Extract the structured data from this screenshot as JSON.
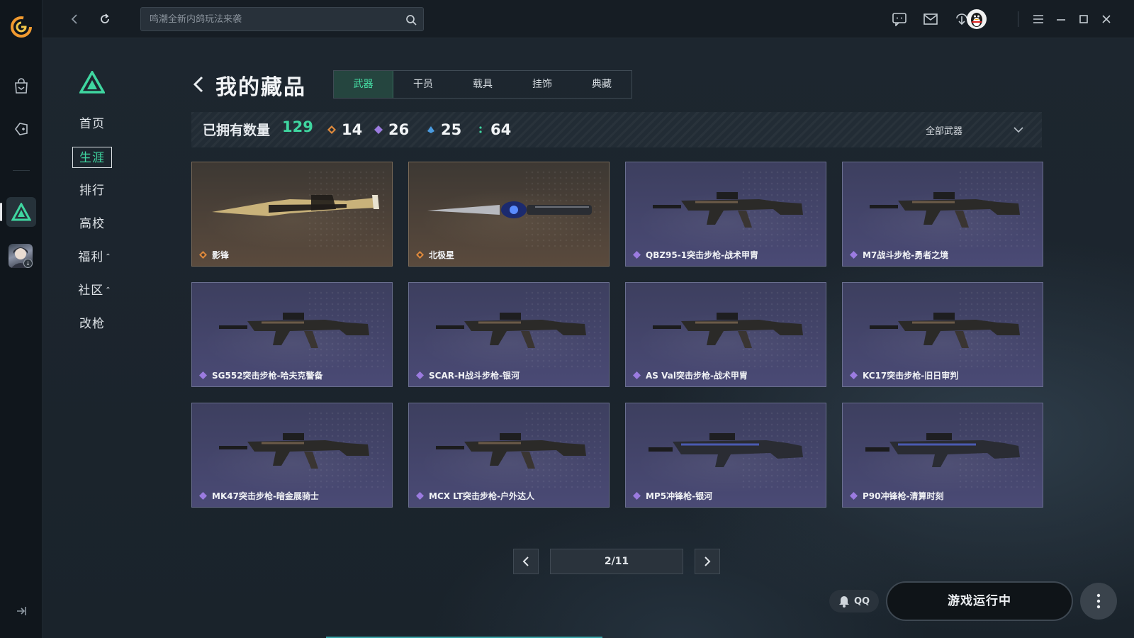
{
  "topbar": {
    "search_placeholder": "鸣潮全新内鸽玩法来袭"
  },
  "subnav": {
    "items": [
      {
        "label": "首页"
      },
      {
        "label": "生涯"
      },
      {
        "label": "排行"
      },
      {
        "label": "高校"
      },
      {
        "label": "福利"
      },
      {
        "label": "社区"
      },
      {
        "label": "改枪"
      }
    ],
    "active_index": 1
  },
  "page": {
    "title": "我的藏品",
    "tabs": [
      "武器",
      "干员",
      "载具",
      "挂饰",
      "典藏"
    ],
    "active_tab": "武器"
  },
  "stats": {
    "owned_label": "已拥有数量",
    "owned_value": "129",
    "rarities": [
      {
        "value": "14",
        "color": "#e08a3c"
      },
      {
        "value": "26",
        "color": "#9b7be0"
      },
      {
        "value": "25",
        "color": "#4a9be0"
      },
      {
        "value": "64",
        "color": "#3fd6a0"
      }
    ],
    "filter_label": "全部武器"
  },
  "cards": [
    {
      "name": "影锋",
      "rarity": "gold",
      "gem_color": "#e08a3c",
      "kind": "blade"
    },
    {
      "name": "北极星",
      "rarity": "gold",
      "gem_color": "#e08a3c",
      "kind": "knife"
    },
    {
      "name": "QBZ95-1突击步枪-战术甲胄",
      "rarity": "purple",
      "gem_color": "#9b7be0",
      "kind": "rifle"
    },
    {
      "name": "M7战斗步枪-勇者之境",
      "rarity": "purple",
      "gem_color": "#9b7be0",
      "kind": "rifle"
    },
    {
      "name": "SG552突击步枪-哈夫克警备",
      "rarity": "purple",
      "gem_color": "#9b7be0",
      "kind": "rifle"
    },
    {
      "name": "SCAR-H战斗步枪-银河",
      "rarity": "purple",
      "gem_color": "#9b7be0",
      "kind": "rifle"
    },
    {
      "name": "AS Val突击步枪-战术甲胄",
      "rarity": "purple",
      "gem_color": "#9b7be0",
      "kind": "rifle"
    },
    {
      "name": "KC17突击步枪-旧日审判",
      "rarity": "purple",
      "gem_color": "#9b7be0",
      "kind": "rifle"
    },
    {
      "name": "MK47突击步枪-暗金展骑士",
      "rarity": "purple",
      "gem_color": "#9b7be0",
      "kind": "rifle"
    },
    {
      "name": "MCX LT突击步枪-户外达人",
      "rarity": "purple",
      "gem_color": "#9b7be0",
      "kind": "rifle"
    },
    {
      "name": "MP5冲锋枪-银河",
      "rarity": "purple",
      "gem_color": "#9b7be0",
      "kind": "smg"
    },
    {
      "name": "P90冲锋枪-清算时刻",
      "rarity": "purple",
      "gem_color": "#9b7be0",
      "kind": "smg"
    }
  ],
  "pagination": {
    "label": "2/11",
    "current": 2,
    "total": 11
  },
  "footer": {
    "qq_label": "QQ",
    "run_label": "游戏运行中"
  },
  "theme": {
    "accent": "#3fd6a0",
    "background": "#1b232b"
  }
}
